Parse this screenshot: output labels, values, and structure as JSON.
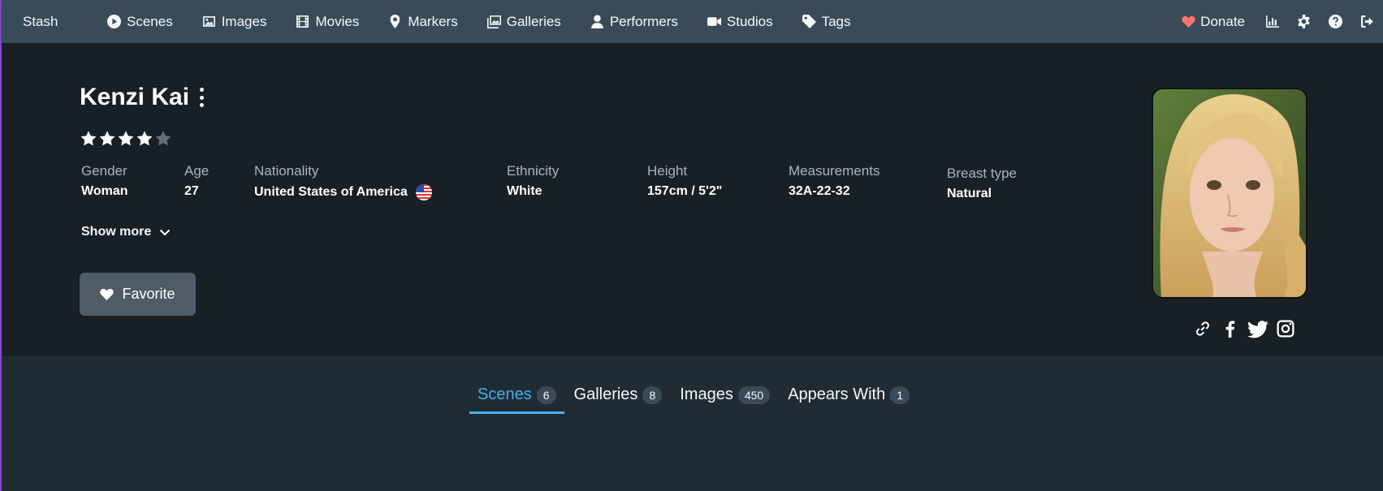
{
  "nav": {
    "brand": "Stash",
    "items": [
      {
        "label": "Scenes",
        "icon": "play-circle-icon"
      },
      {
        "label": "Images",
        "icon": "image-icon"
      },
      {
        "label": "Movies",
        "icon": "film-icon"
      },
      {
        "label": "Markers",
        "icon": "map-marker-icon"
      },
      {
        "label": "Galleries",
        "icon": "images-icon"
      },
      {
        "label": "Performers",
        "icon": "user-icon"
      },
      {
        "label": "Studios",
        "icon": "video-icon"
      },
      {
        "label": "Tags",
        "icon": "tag-icon"
      }
    ],
    "donate_label": "Donate",
    "right_icons": [
      "chart-icon",
      "gear-icon",
      "help-icon",
      "logout-icon"
    ]
  },
  "performer": {
    "name": "Kenzi Kai",
    "rating": 4,
    "rating_max": 5,
    "details": [
      {
        "label": "Gender",
        "value": "Woman"
      },
      {
        "label": "Age",
        "value": "27"
      },
      {
        "label": "Nationality",
        "value": "United States of America"
      },
      {
        "label": "Ethnicity",
        "value": "White"
      },
      {
        "label": "Height",
        "value": "157cm / 5'2\""
      },
      {
        "label": "Measurements",
        "value": "32A-22-32"
      },
      {
        "label": "Breast type",
        "value": "Natural"
      }
    ],
    "show_more_label": "Show more",
    "favorite_label": "Favorite",
    "links": [
      "link-icon",
      "facebook-icon",
      "twitter-icon",
      "instagram-icon"
    ]
  },
  "tabs": [
    {
      "label": "Scenes",
      "count": "6",
      "active": true
    },
    {
      "label": "Galleries",
      "count": "8",
      "active": false
    },
    {
      "label": "Images",
      "count": "450",
      "active": false
    },
    {
      "label": "Appears With",
      "count": "1",
      "active": false
    }
  ],
  "colors": {
    "navbar": "#394b59",
    "header": "#182026",
    "page": "#202b33",
    "accent": "#48aff0",
    "donate_heart": "#ff7373",
    "star_filled": "#ffffff",
    "star_empty": "#5c7080"
  }
}
